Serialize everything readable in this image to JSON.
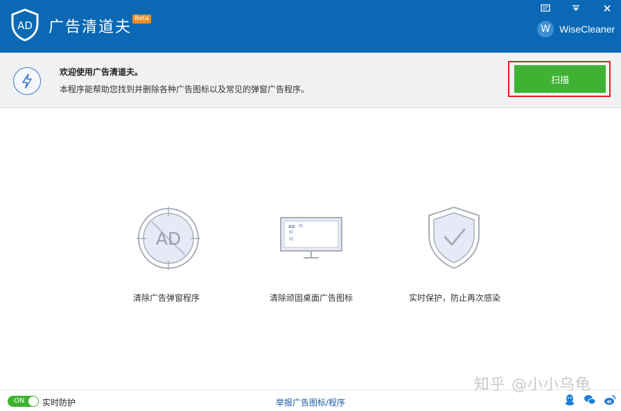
{
  "app": {
    "title": "广告清道夫",
    "beta": "Beta",
    "logo_text": "AD",
    "brand_badge": "W",
    "brand_name": "WiseCleaner"
  },
  "info": {
    "welcome": "欢迎使用广告清道夫。",
    "description": "本程序能帮助您找到并删除各种广告图标以及常见的弹窗广告程序。",
    "scan_label": "扫描"
  },
  "features": [
    {
      "label": "清除广告弹窗程序",
      "icon": "ad-block-icon",
      "icon_text": "AD"
    },
    {
      "label": "清除顽固桌面广告图标",
      "icon": "monitor-icon",
      "icon_text": "AD"
    },
    {
      "label": "实时保护，防止再次感染",
      "icon": "shield-check-icon"
    }
  ],
  "footer": {
    "toggle_state": "ON",
    "realtime_label": "实时防护",
    "report_link": "举报广告图标/程序",
    "watermark": "知乎 @小小乌龟"
  },
  "colors": {
    "titlebar": "#0a68b4",
    "accent_green": "#3fb233",
    "highlight_red": "#e02020",
    "link_blue": "#1a5ca8"
  }
}
